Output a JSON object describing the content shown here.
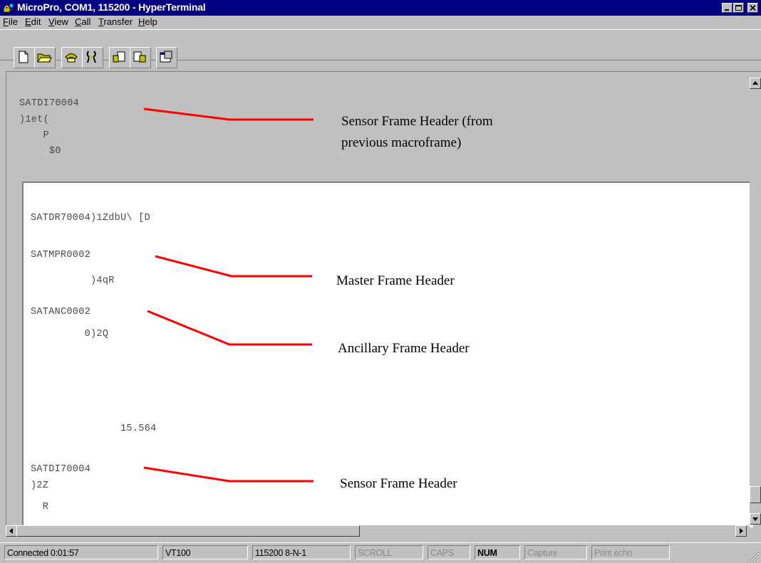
{
  "window": {
    "title": "MicroPro, COM1, 115200 - HyperTerminal",
    "app_icon": "hyperterminal-phone-icon",
    "controls": [
      "minimize-icon",
      "maximize-icon",
      "close-icon"
    ]
  },
  "menu": {
    "file": "File",
    "edit": "Edit",
    "view": "View",
    "call": "Call",
    "transfer": "Transfer",
    "help": "Help"
  },
  "toolbar": {
    "buttons": [
      "new-document-icon",
      "open-folder-icon",
      "connect-phone-icon",
      "disconnect-phone-icon",
      "send-file-icon",
      "receive-file-icon",
      "properties-icon"
    ]
  },
  "terminal": {
    "upper_lines": [
      "SATDI70004",
      ")1et(",
      "    P",
      "     $0"
    ],
    "lower_lines": [
      "SATDR70004)1ZdbU\\ [D",
      "SATMPR0002",
      "          )4qR",
      "SATANC0002",
      "         0)2Q",
      "               15.564",
      "SATDI70004",
      ")2Z",
      "  R"
    ]
  },
  "annotations": {
    "sensor_prev_line1": "Sensor Frame Header (from",
    "sensor_prev_line2": "previous macroframe)",
    "master": "Master Frame Header",
    "ancillary": "Ancillary Frame Header",
    "sensor": "Sensor Frame Header",
    "line_color": "#ff0000"
  },
  "statusbar": {
    "connected": "Connected 0:01:57",
    "emulation": "VT100",
    "settings": "115200 8-N-1",
    "scroll": "SCROLL",
    "caps": "CAPS",
    "num": "NUM",
    "capture": "Capture",
    "print_echo": "Print echo"
  }
}
